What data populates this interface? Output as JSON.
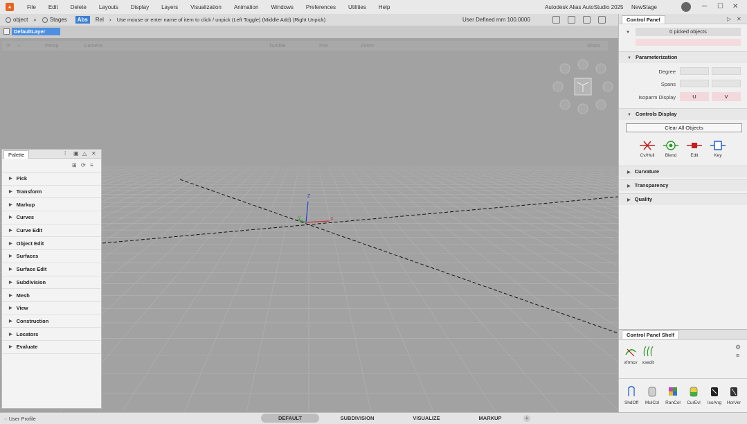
{
  "menubar": {
    "items": [
      "File",
      "Edit",
      "Delete",
      "Layouts",
      "Display",
      "Layers",
      "Visualization",
      "Animation",
      "Windows",
      "Preferences",
      "Utilities",
      "Help"
    ],
    "app_title": "Autodesk Alias AutoStudio 2025",
    "stage": "NewStage"
  },
  "toolbar": {
    "object_label": "object",
    "stages_label": "Stages",
    "abs_label": "Abs",
    "rel_label": "Rel",
    "prompt": "Use mouse or enter name of item to click / unpick (Left Toggle) (Middle Add) (Right Unpick)",
    "units": "User Defined   mm   100.0000"
  },
  "layer": {
    "name": "DefaultLayer"
  },
  "viewstrip": {
    "left_label": "Persp",
    "camera_label": "Camera",
    "tumble": "Tumble",
    "pan": "Pan",
    "zoom": "Zoom",
    "show": "Show"
  },
  "axes": {
    "x": "X",
    "y": "Y",
    "z": "Z"
  },
  "palette": {
    "tab": "Palette",
    "items": [
      "Pick",
      "Transform",
      "Markup",
      "Curves",
      "Curve Edit",
      "Object Edit",
      "Surfaces",
      "Surface Edit",
      "Subdivision",
      "Mesh",
      "View",
      "Construction",
      "Locators",
      "Evaluate"
    ]
  },
  "control_panel": {
    "tab": "Control Panel",
    "picked": "0 picked objects",
    "parameterization": "Parameterization",
    "degree": "Degree",
    "spans": "Spans",
    "isoparm": "Isoparm Display",
    "u": "U",
    "v": "V",
    "controls_display": "Controls Display",
    "clear_all": "Clear All Objects",
    "icons": [
      "Cv/Hull",
      "Blend",
      "Edit",
      "Key"
    ],
    "curvature": "Curvature",
    "transparency": "Transparency",
    "quality": "Quality"
  },
  "shelf": {
    "tab": "Control Panel Shelf",
    "top_items": [
      "xfrmcv",
      "xsedit"
    ],
    "bottom_items": [
      "ShdOff",
      "MulCol",
      "RanCol",
      "CurEvl",
      "IsoAng",
      "HorVer"
    ]
  },
  "bottom": {
    "user_profile": "User Profile",
    "tabs": [
      "DEFAULT",
      "SUBDIVISION",
      "VISUALIZE",
      "MARKUP"
    ]
  },
  "colors": {
    "accent": "#3c7fd1",
    "brand": "#e8641e",
    "x_axis": "#d03030",
    "y_axis": "#2a9a2a",
    "z_axis": "#2040d0"
  }
}
